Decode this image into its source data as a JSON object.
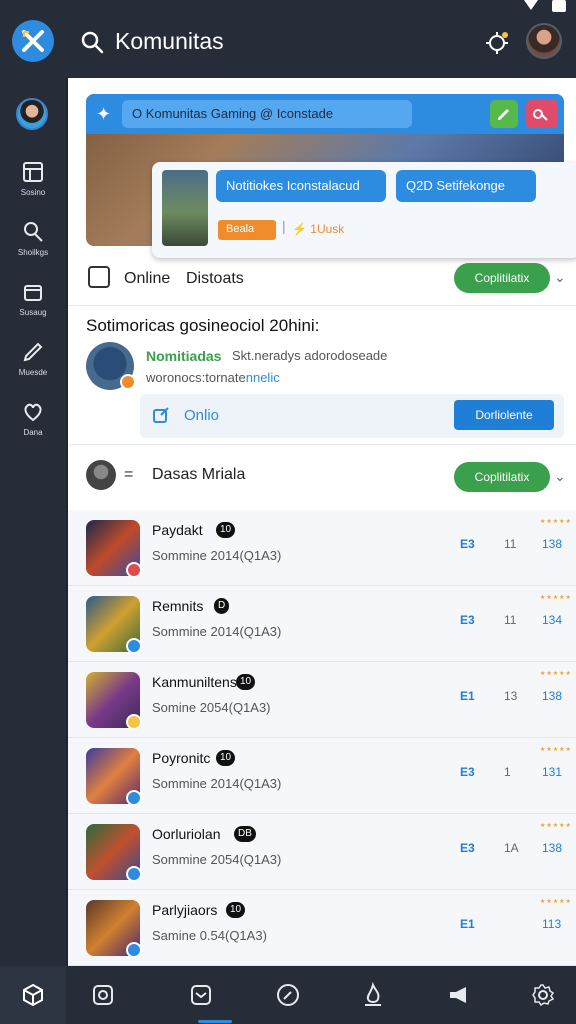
{
  "header": {
    "title": "Komunitas"
  },
  "sidebar": {
    "items": [
      {
        "label": "Sosino"
      },
      {
        "label": "Shoilkgs"
      },
      {
        "label": "Susaug"
      },
      {
        "label": "Muesde"
      },
      {
        "label": "Dana"
      }
    ]
  },
  "hero": {
    "bar_text": "O Komunitas Gaming @ Iconstade",
    "button_a": "Notitiokes Iconstalacud",
    "button_b": "Q2D Setifekonge",
    "tag": "Beala",
    "task": "1Uusk"
  },
  "online_row": {
    "label_a": "Online",
    "label_b": "Distoats",
    "button": "Coplitilatix"
  },
  "promo": {
    "title": "Sotimoricas gosineociol 20hini:",
    "name": "Nomitiadas",
    "subtitle": "Skt.neradys adorodoseade",
    "description_a": "woronocs:tornate",
    "description_b": "nnelic",
    "box_label": "Onlio",
    "box_button": "Dorliolente"
  },
  "data_row": {
    "label": "Dasas Mriala",
    "button": "Coplitilatix"
  },
  "games": [
    {
      "name": "Paydakt",
      "badge": "10",
      "meta": "Sommine  2014(Q1A3)",
      "c1": "E3",
      "c2": "11",
      "c3": "138"
    },
    {
      "name": "Remnits",
      "badge": "D",
      "meta": "Sommine  2014(Q1A3)",
      "c1": "E3",
      "c2": "11",
      "c3": "134"
    },
    {
      "name": "Kanmuniltens",
      "badge": "10",
      "meta": "Somine  2054(Q1A3)",
      "c1": "E1",
      "c2": "13",
      "c3": "138"
    },
    {
      "name": "Poyronitc",
      "badge": "10",
      "meta": "Sommine  2014(Q1A3)",
      "c1": "E3",
      "c2": "1",
      "c3": "131"
    },
    {
      "name": "Oorluriolan",
      "badge": "DB",
      "meta": "Sommine  2054(Q1A3)",
      "c1": "E3",
      "c2": "1A",
      "c3": "138"
    },
    {
      "name": "Parlyjiaors",
      "badge": "10",
      "meta": "Samine  0.54(Q1A3)",
      "c1": "E1",
      "c2": "",
      "c3": "113"
    }
  ],
  "colors": {
    "accent": "#2d8ce0",
    "green": "#3aa04b",
    "dark": "#262c38"
  }
}
